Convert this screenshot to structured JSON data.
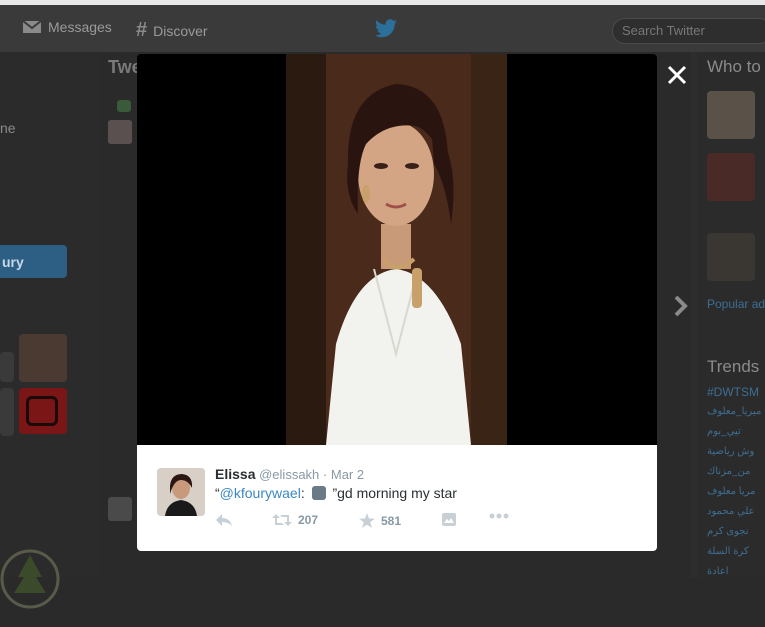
{
  "nav": {
    "messages": "Messages",
    "discover": "Discover",
    "search_placeholder": "Search Twitter"
  },
  "left": {
    "partial_text": "ne",
    "edit_button": "ury"
  },
  "center": {
    "title_partial": "Twe"
  },
  "right": {
    "who_to_follow": "Who to",
    "popular": "Popular ad",
    "trends_title": "Trends",
    "trends": [
      "#DWTSM",
      "ميريا_معلوف",
      "تيي_بوم",
      "وش رياضية",
      "من_مزناك",
      "مريا معلوف",
      "علي محمود",
      "نجوى كرم",
      "كرة السلة",
      "اعادة"
    ]
  },
  "tweet": {
    "name": "Elissa",
    "handle": "@elissakh",
    "separator": "·",
    "date": "Mar 2",
    "quote_open": "“",
    "mention": "@kfourywael",
    "colon": ":",
    "body": "”gd morning my star",
    "retweets": "207",
    "favorites": "581"
  },
  "icons": {
    "messages": "envelope-icon",
    "discover": "hashtag-icon",
    "logo": "twitter-bird-icon",
    "close": "close-icon",
    "next": "chevron-right-icon",
    "reply": "reply-icon",
    "retweet": "retweet-icon",
    "favorite": "star-icon",
    "media": "image-icon",
    "more": "more-icon"
  },
  "colors": {
    "link": "#3b88c3",
    "name": "#292f33",
    "meta": "#8899a6"
  }
}
